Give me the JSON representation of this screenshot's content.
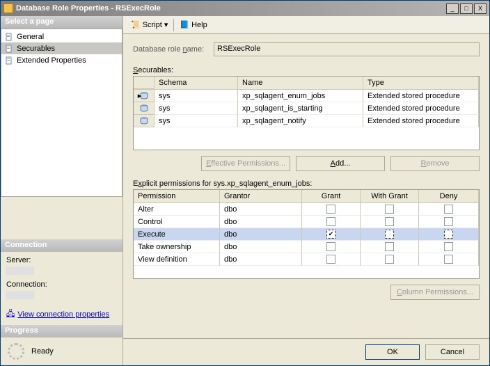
{
  "window": {
    "title": "Database Role Properties - RSExecRole",
    "min": "_",
    "max": "□",
    "close": "X"
  },
  "left": {
    "select_page": "Select a page",
    "pages": [
      {
        "label": "General",
        "selected": false
      },
      {
        "label": "Securables",
        "selected": true
      },
      {
        "label": "Extended Properties",
        "selected": false
      }
    ],
    "connection_header": "Connection",
    "server_label": "Server:",
    "connection_label": "Connection:",
    "view_conn": "View connection properties",
    "progress_header": "Progress",
    "ready": "Ready"
  },
  "toolbar": {
    "script": "Script",
    "help": "Help",
    "dropdown_glyph": "▾"
  },
  "main": {
    "role_name_label": "Database role name:",
    "role_name": "RSExecRole",
    "securables_label": "Securables:",
    "grid1": {
      "headers": [
        "",
        "Schema",
        "Name",
        "Type"
      ],
      "rows": [
        {
          "schema": "sys",
          "name": "xp_sqlagent_enum_jobs",
          "type": "Extended stored procedure",
          "selected": true
        },
        {
          "schema": "sys",
          "name": "xp_sqlagent_is_starting",
          "type": "Extended stored procedure",
          "selected": false
        },
        {
          "schema": "sys",
          "name": "xp_sqlagent_notify",
          "type": "Extended stored procedure",
          "selected": false
        }
      ]
    },
    "eff_perm": "Effective Permissions...",
    "add": "Add...",
    "remove": "Remove",
    "explicit_label": "Explicit permissions for sys.xp_sqlagent_enum_jobs:",
    "grid2": {
      "headers": [
        "Permission",
        "Grantor",
        "Grant",
        "With Grant",
        "Deny"
      ],
      "rows": [
        {
          "permission": "Alter",
          "grantor": "dbo",
          "grant": false,
          "with_grant": false,
          "deny": false,
          "selected": false
        },
        {
          "permission": "Control",
          "grantor": "dbo",
          "grant": false,
          "with_grant": false,
          "deny": false,
          "selected": false
        },
        {
          "permission": "Execute",
          "grantor": "dbo",
          "grant": true,
          "with_grant": false,
          "deny": false,
          "selected": true
        },
        {
          "permission": "Take ownership",
          "grantor": "dbo",
          "grant": false,
          "with_grant": false,
          "deny": false,
          "selected": false
        },
        {
          "permission": "View definition",
          "grantor": "dbo",
          "grant": false,
          "with_grant": false,
          "deny": false,
          "selected": false
        }
      ]
    },
    "col_perm": "Column Permissions..."
  },
  "footer": {
    "ok": "OK",
    "cancel": "Cancel"
  }
}
